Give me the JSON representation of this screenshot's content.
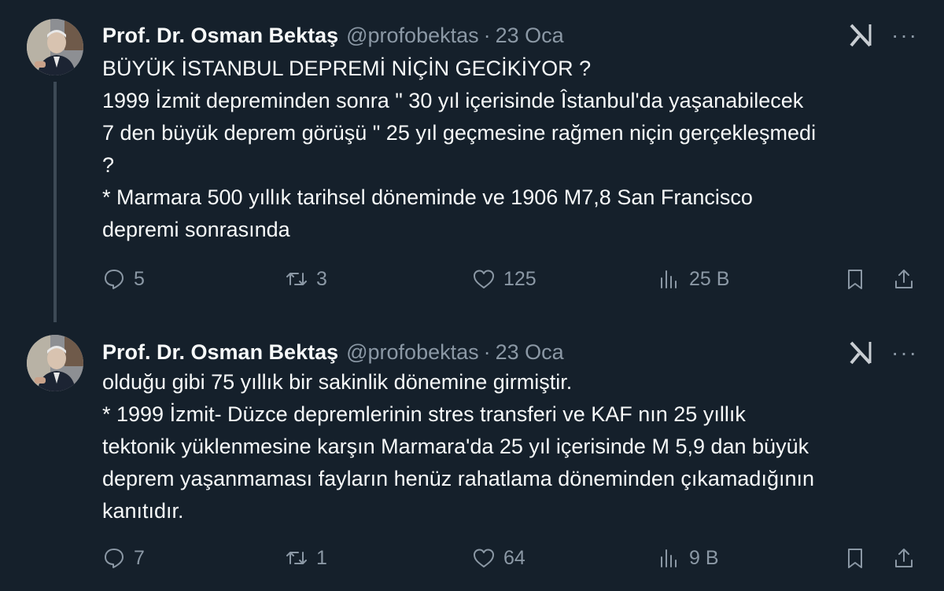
{
  "tweets": [
    {
      "author_name": "Prof. Dr. Osman Bektaş",
      "handle": "@profobektas",
      "separator": "·",
      "date": "23 Oca",
      "more_label": "···",
      "lines": [
        "BÜYÜK İSTANBUL DEPREMİ NİÇİN GECİKİYOR ?",
        "1999 İzmit depreminden sonra \" 30 yıl içerisinde Îstanbul'da yaşanabilecek",
        "7 den büyük deprem  görüşü \" 25 yıl geçmesine rağmen niçin gerçekleşmedi",
        "?",
        "* Marmara 500 yıllık tarihsel döneminde ve  1906 M7,8 San Francisco",
        "depremi sonrasında"
      ],
      "stats": {
        "replies": "5",
        "reposts": "3",
        "likes": "125",
        "views": "25 B"
      }
    },
    {
      "author_name": "Prof. Dr. Osman Bektaş",
      "handle": "@profobektas",
      "separator": "·",
      "date": "23 Oca",
      "more_label": "···",
      "lines": [
        "olduğu gibi 75 yıllık bir sakinlik dönemine girmiştir.",
        "* 1999 İzmit- Düzce depremlerinin stres transferi ve KAF nın 25 yıllık",
        "tektonik yüklenmesine karşın Marmara'da 25 yıl içerisinde M 5,9 dan büyük",
        "deprem yaşanmaması fayların henüz rahatlama döneminden çıkamadığının",
        "kanıtıdır."
      ],
      "stats": {
        "replies": "7",
        "reposts": "1",
        "likes": "64",
        "views": "9 B"
      }
    }
  ],
  "colors": {
    "background": "#15202b",
    "text": "#f7f9f9",
    "muted": "#8b98a5",
    "thread_line": "#3d4a56"
  },
  "icons": [
    "grok-icon",
    "more-icon",
    "reply-icon",
    "repost-icon",
    "like-icon",
    "views-icon",
    "bookmark-icon",
    "share-icon"
  ]
}
